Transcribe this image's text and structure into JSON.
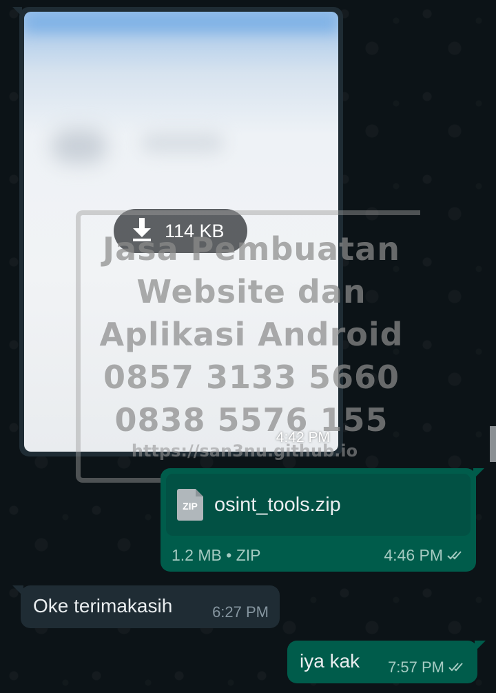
{
  "chat": {
    "image_message": {
      "download_size": "114 KB",
      "time": "4:42 PM"
    },
    "watermark": {
      "lines": [
        "Jasa Pembuatan",
        "Website dan",
        "Aplikasi Android",
        "0857 3133 5660",
        "0838 5576 155"
      ],
      "url": "https://san3nu.github.io"
    },
    "file_message": {
      "icon_label": "ZIP",
      "file_name": "osint_tools.zip",
      "meta": "1.2 MB • ZIP",
      "time": "4:46 PM"
    },
    "incoming_message": {
      "text": "Oke terimakasih",
      "time": "6:27 PM"
    },
    "outgoing_message": {
      "text": "iya kak",
      "time": "7:57 PM"
    }
  },
  "colors": {
    "outgoing_bubble": "#005c4b",
    "incoming_bubble": "#1f2c34",
    "background": "#0b141a",
    "read_tick": "#a5cbc2"
  },
  "icons": {
    "download": "download-arrow-icon",
    "file": "zip-file-icon",
    "status": "double-check-icon"
  }
}
